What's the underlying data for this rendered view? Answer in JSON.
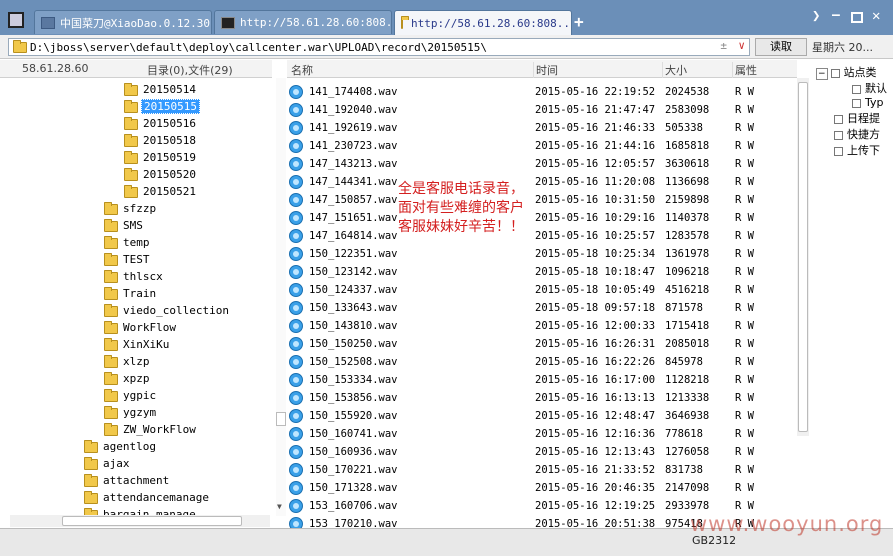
{
  "tabs": [
    {
      "label": "中国菜刀@XiaoDao.0.12.30",
      "icon": "tab-doc-icon"
    },
    {
      "label": "http://58.61.28.60:808...",
      "icon": "terminal-icon"
    },
    {
      "label": "http://58.61.28.60:808...",
      "icon": "folder-icon"
    }
  ],
  "address": {
    "path": "D:\\jboss\\server\\default\\deploy\\callcenter.war\\UPLOAD\\record\\20150515\\",
    "updown": "± "
  },
  "read_button": "读取",
  "date_label": "星期六 20...",
  "left_header": {
    "host": "58.61.28.60",
    "summary": "目录(0),文件(29)"
  },
  "columns": {
    "name": "名称",
    "time": "时间",
    "size": "大小",
    "attr": "属性"
  },
  "tree": [
    {
      "label": "20150514",
      "level": 2
    },
    {
      "label": "20150515",
      "level": 2,
      "selected": true
    },
    {
      "label": "20150516",
      "level": 2
    },
    {
      "label": "20150518",
      "level": 2
    },
    {
      "label": "20150519",
      "level": 2
    },
    {
      "label": "20150520",
      "level": 2
    },
    {
      "label": "20150521",
      "level": 2
    },
    {
      "label": "sfzzp",
      "level": 1
    },
    {
      "label": "SMS",
      "level": 1
    },
    {
      "label": "temp",
      "level": 1
    },
    {
      "label": "TEST",
      "level": 1
    },
    {
      "label": "thlscx",
      "level": 1
    },
    {
      "label": "Train",
      "level": 1
    },
    {
      "label": "viedo_collection",
      "level": 1
    },
    {
      "label": "WorkFlow",
      "level": 1
    },
    {
      "label": "XinXiKu",
      "level": 1
    },
    {
      "label": "xlzp",
      "level": 1
    },
    {
      "label": "xpzp",
      "level": 1
    },
    {
      "label": "ygpic",
      "level": 1
    },
    {
      "label": "ygzym",
      "level": 1
    },
    {
      "label": "ZW_WorkFlow",
      "level": 1
    },
    {
      "label": "agentlog",
      "level": 0
    },
    {
      "label": "ajax",
      "level": 0
    },
    {
      "label": "attachment",
      "level": 0
    },
    {
      "label": "attendancemanage",
      "level": 0
    },
    {
      "label": "bargain_manage",
      "level": 0
    }
  ],
  "files": [
    {
      "name": "141_174408.wav",
      "time": "2015-05-16 22:19:52",
      "size": "2024538",
      "attr": "R W"
    },
    {
      "name": "141_192040.wav",
      "time": "2015-05-16 21:47:47",
      "size": "2583098",
      "attr": "R W"
    },
    {
      "name": "141_192619.wav",
      "time": "2015-05-16 21:46:33",
      "size": "505338",
      "attr": "R W"
    },
    {
      "name": "141_230723.wav",
      "time": "2015-05-16 21:44:16",
      "size": "1685818",
      "attr": "R W"
    },
    {
      "name": "147_143213.wav",
      "time": "2015-05-16 12:05:57",
      "size": "3630618",
      "attr": "R W"
    },
    {
      "name": "147_144341.wav",
      "time": "2015-05-16 11:20:08",
      "size": "1136698",
      "attr": "R W"
    },
    {
      "name": "147_150857.wav",
      "time": "2015-05-16 10:31:50",
      "size": "2159898",
      "attr": "R W"
    },
    {
      "name": "147_151651.wav",
      "time": "2015-05-16 10:29:16",
      "size": "1140378",
      "attr": "R W"
    },
    {
      "name": "147_164814.wav",
      "time": "2015-05-16 10:25:57",
      "size": "1283578",
      "attr": "R W"
    },
    {
      "name": "150_122351.wav",
      "time": "2015-05-18 10:25:34",
      "size": "1361978",
      "attr": "R W"
    },
    {
      "name": "150_123142.wav",
      "time": "2015-05-18 10:18:47",
      "size": "1096218",
      "attr": "R W"
    },
    {
      "name": "150_124337.wav",
      "time": "2015-05-18 10:05:49",
      "size": "4516218",
      "attr": "R W"
    },
    {
      "name": "150_133643.wav",
      "time": "2015-05-18 09:57:18",
      "size": "871578",
      "attr": "R W"
    },
    {
      "name": "150_143810.wav",
      "time": "2015-05-16 12:00:33",
      "size": "1715418",
      "attr": "R W"
    },
    {
      "name": "150_150250.wav",
      "time": "2015-05-16 16:26:31",
      "size": "2085018",
      "attr": "R W"
    },
    {
      "name": "150_152508.wav",
      "time": "2015-05-16 16:22:26",
      "size": "845978",
      "attr": "R W"
    },
    {
      "name": "150_153334.wav",
      "time": "2015-05-16 16:17:00",
      "size": "1128218",
      "attr": "R W"
    },
    {
      "name": "150_153856.wav",
      "time": "2015-05-16 16:13:13",
      "size": "1213338",
      "attr": "R W"
    },
    {
      "name": "150_155920.wav",
      "time": "2015-05-16 12:48:47",
      "size": "3646938",
      "attr": "R W"
    },
    {
      "name": "150_160741.wav",
      "time": "2015-05-16 12:16:36",
      "size": "778618",
      "attr": "R W"
    },
    {
      "name": "150_160936.wav",
      "time": "2015-05-16 12:13:43",
      "size": "1276058",
      "attr": "R W"
    },
    {
      "name": "150_170221.wav",
      "time": "2015-05-16 21:33:52",
      "size": "831738",
      "attr": "R W"
    },
    {
      "name": "150_171328.wav",
      "time": "2015-05-16 20:46:35",
      "size": "2147098",
      "attr": "R W"
    },
    {
      "name": "153_160706.wav",
      "time": "2015-05-16 12:19:25",
      "size": "2933978",
      "attr": "R W"
    },
    {
      "name": "153_170210.wav",
      "time": "2015-05-16 20:51:38",
      "size": "975418",
      "attr": "R W"
    }
  ],
  "annotation": [
    "全是客服电话录音，",
    "面对有些难缠的客户",
    "客服妹妹好辛苦！！"
  ],
  "right_panel": [
    "站点类",
    "默认",
    "Typ",
    "日程提",
    "快捷方",
    "上传下"
  ],
  "status": {
    "encoding": "GB2312"
  },
  "watermark": "www.wooyun.org",
  "colors": {
    "tabbar": "#6b8fb8",
    "selection": "#3399ff",
    "annotation": "#d42020"
  }
}
